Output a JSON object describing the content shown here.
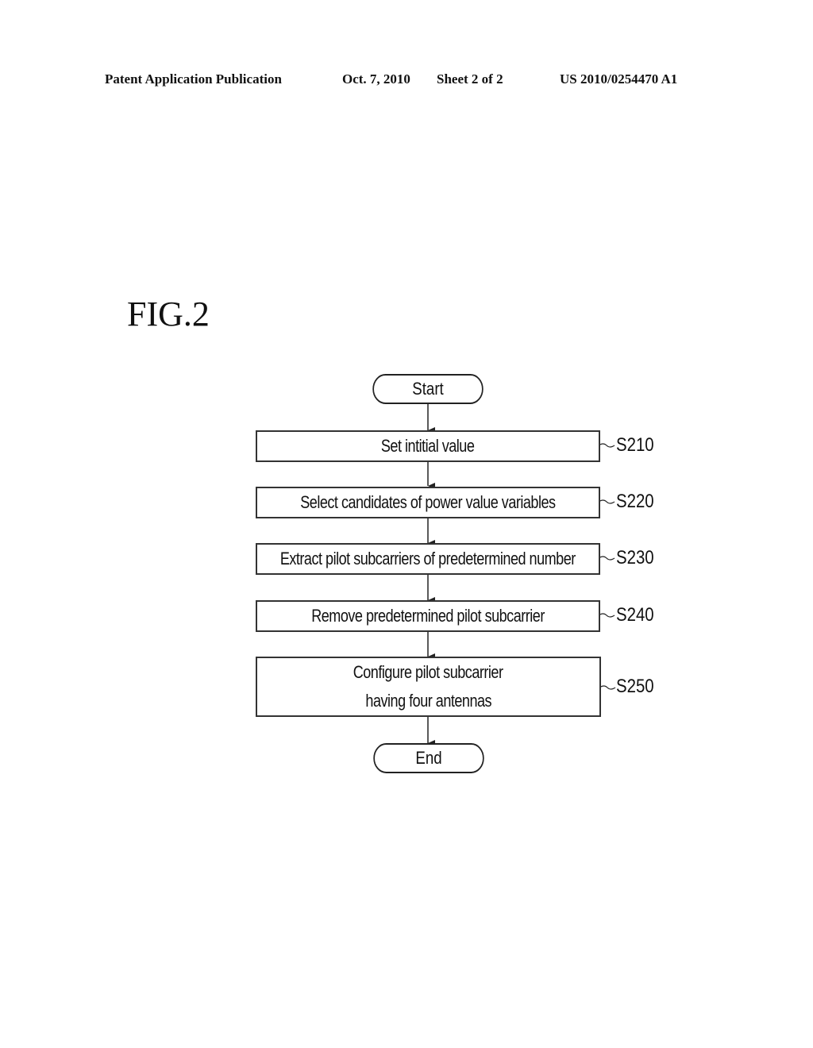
{
  "header": {
    "publication": "Patent Application Publication",
    "date": "Oct. 7, 2010",
    "sheet": "Sheet 2 of 2",
    "number": "US 2010/0254470 A1"
  },
  "figure": {
    "label": "FIG.2"
  },
  "flowchart": {
    "start": "Start",
    "end": "End",
    "steps": [
      {
        "id": "S210",
        "lines": [
          "Set intitial value"
        ]
      },
      {
        "id": "S220",
        "lines": [
          "Select candidates of power value variables"
        ]
      },
      {
        "id": "S230",
        "lines": [
          "Extract pilot subcarriers of predetermined number"
        ]
      },
      {
        "id": "S240",
        "lines": [
          "Remove predetermined pilot subcarrier"
        ]
      },
      {
        "id": "S250",
        "lines": [
          "Configure pilot subcarrier",
          "having four antennas"
        ]
      }
    ]
  }
}
